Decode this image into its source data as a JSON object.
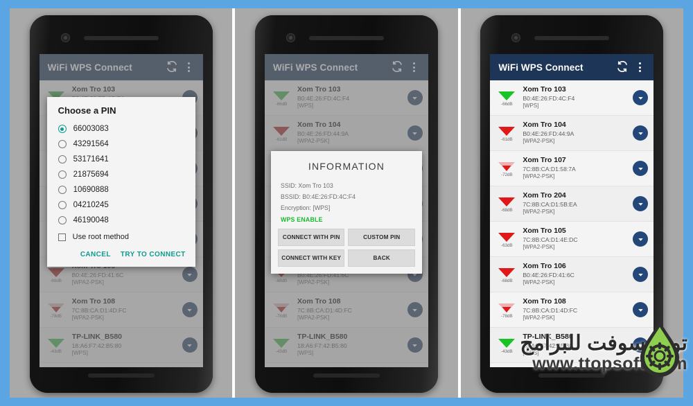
{
  "theme": {
    "page_background": "#5ba6e2",
    "panel_background": "#a9a9a9",
    "appbar_color": "#1d3557",
    "accent_teal": "#0f9b8e",
    "wps_green": "#18b92e",
    "expand_button": "#24477a"
  },
  "app": {
    "title": "WiFi WPS Connect",
    "refresh_icon": "refresh-icon",
    "overflow_icon": "overflow-menu-icon"
  },
  "networks": [
    {
      "ssid": "Xom Tro 103",
      "bssid": "B0:4E:26:FD:4C:F4",
      "encryption": "[WPS]",
      "signal": "-66dB",
      "strength": "green"
    },
    {
      "ssid": "Xom Tro 104",
      "bssid": "B0:4E:26:FD:44:9A",
      "encryption": "[WPA2-PSK]",
      "signal": "-61dB",
      "strength": "red"
    },
    {
      "ssid": "Xom Tro 107",
      "bssid": "7C:8B:CA:D1:58:7A",
      "encryption": "[WPA2-PSK]",
      "signal": "-72dB",
      "strength": "red-weak"
    },
    {
      "ssid": "Xom Tro 204",
      "bssid": "7C:8B:CA:D1:5B:EA",
      "encryption": "[WPA2-PSK]",
      "signal": "-68dB",
      "strength": "red"
    },
    {
      "ssid": "Xom Tro 105",
      "bssid": "7C:8B:CA:D1:4E:DC",
      "encryption": "[WPA2-PSK]",
      "signal": "-63dB",
      "strength": "red"
    },
    {
      "ssid": "Xom Tro 106",
      "bssid": "B0:4E:26:FD:41:6C",
      "encryption": "[WPA2-PSK]",
      "signal": "-68dB",
      "strength": "red"
    },
    {
      "ssid": "Xom Tro 108",
      "bssid": "7C:8B:CA:D1:4D:FC",
      "encryption": "[WPA2-PSK]",
      "signal": "-78dB",
      "strength": "red-weak"
    },
    {
      "ssid": "TP-LINK_B580",
      "bssid": "18:A6:F7:42:B5:80",
      "encryption": "[WPS]",
      "signal": "-43dB",
      "strength": "green"
    }
  ],
  "pin_dialog": {
    "title": "Choose a PIN",
    "pins": [
      {
        "value": "66003083",
        "selected": true
      },
      {
        "value": "43291564",
        "selected": false
      },
      {
        "value": "53171641",
        "selected": false
      },
      {
        "value": "21875694",
        "selected": false
      },
      {
        "value": "10690888",
        "selected": false
      },
      {
        "value": "04210245",
        "selected": false
      },
      {
        "value": "46190048",
        "selected": false
      }
    ],
    "root_checkbox_label": "Use root method",
    "root_checked": false,
    "cancel_label": "CANCEL",
    "connect_label": "TRY TO CONNECT"
  },
  "info_dialog": {
    "title": "INFORMATION",
    "ssid_line": "SSID: Xom Tro 103",
    "bssid_line": "BSSID: B0:4E:26:FD:4C:F4",
    "encryption_line": "Encryption: [WPS]",
    "wps_status": "WPS ENABLE",
    "buttons": [
      "CONNECT WITH PIN",
      "CUSTOM PIN",
      "CONNECT WITH KEY",
      "BACK"
    ]
  },
  "watermark": {
    "arabic": "توب سوفت للبرامج",
    "url": "www.ttopsoft.com"
  }
}
